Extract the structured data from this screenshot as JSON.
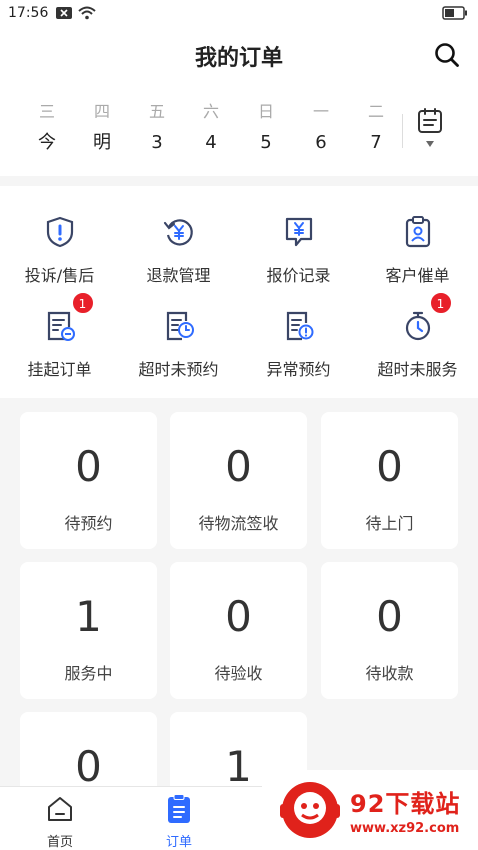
{
  "status_bar": {
    "time": "17:56"
  },
  "header": {
    "title": "我的订单"
  },
  "week": [
    {
      "weekday": "三",
      "date": "今"
    },
    {
      "weekday": "四",
      "date": "明"
    },
    {
      "weekday": "五",
      "date": "3"
    },
    {
      "weekday": "六",
      "date": "4"
    },
    {
      "weekday": "日",
      "date": "5"
    },
    {
      "weekday": "一",
      "date": "6"
    },
    {
      "weekday": "二",
      "date": "7"
    }
  ],
  "menu": [
    {
      "label": "投诉/售后",
      "icon": "shield-alert-icon"
    },
    {
      "label": "退款管理",
      "icon": "refund-icon"
    },
    {
      "label": "报价记录",
      "icon": "quote-icon"
    },
    {
      "label": "客户催单",
      "icon": "clipboard-user-icon"
    },
    {
      "label": "挂起订单",
      "icon": "suspend-order-icon",
      "badge": "1"
    },
    {
      "label": "超时未预约",
      "icon": "overtime-schedule-icon"
    },
    {
      "label": "异常预约",
      "icon": "abnormal-schedule-icon"
    },
    {
      "label": "超时未服务",
      "icon": "stopwatch-icon",
      "badge": "1"
    }
  ],
  "stats": [
    {
      "value": "0",
      "label": "待预约"
    },
    {
      "value": "0",
      "label": "待物流签收"
    },
    {
      "value": "0",
      "label": "待上门"
    },
    {
      "value": "1",
      "label": "服务中"
    },
    {
      "value": "0",
      "label": "待验收"
    },
    {
      "value": "0",
      "label": "待收款"
    },
    {
      "value": "0",
      "label": ""
    },
    {
      "value": "1",
      "label": ""
    }
  ],
  "tabs": [
    {
      "label": "首页",
      "icon": "home-icon"
    },
    {
      "label": "订单",
      "icon": "order-icon",
      "active": true
    }
  ],
  "colors": {
    "accent": "#2f6bff",
    "icon": "#3a4566",
    "badge": "#e8202a",
    "watermark": "#e0221b"
  },
  "watermark": {
    "title": "92下载站",
    "url": "www.xz92.com"
  }
}
